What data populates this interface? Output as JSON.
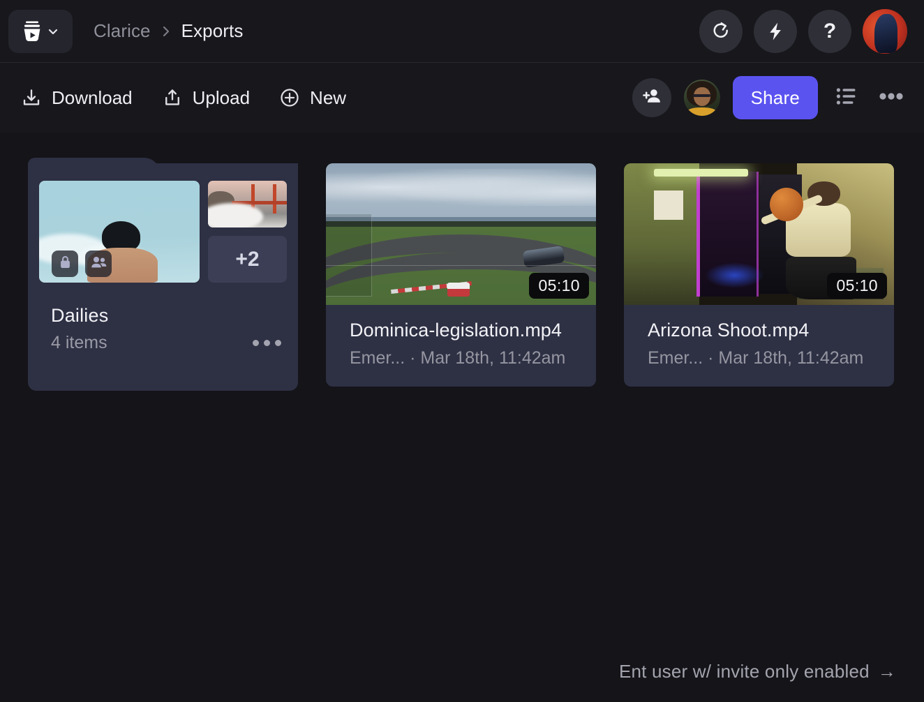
{
  "header": {
    "logo_icon": "frameio-bucket-logo",
    "logo_dropdown_icon": "chevron-down-icon",
    "breadcrumb": {
      "parent": "Clarice",
      "separator": "›",
      "current": "Exports"
    },
    "actions": [
      {
        "name": "refresh",
        "icon": "refresh-icon"
      },
      {
        "name": "lightning",
        "icon": "lightning-bolt-icon"
      },
      {
        "name": "help",
        "icon": "question-mark-icon",
        "glyph": "?"
      }
    ],
    "avatar": {
      "name": "user-avatar",
      "alt": "Account avatar"
    }
  },
  "toolbar": {
    "download_label": "Download",
    "download_icon": "download-icon",
    "upload_label": "Upload",
    "upload_icon": "upload-icon",
    "new_label": "New",
    "new_icon": "plus-circle-icon",
    "add_person_icon": "add-person-icon",
    "collaborator_avatar": "collaborator-avatar",
    "share_label": "Share",
    "share_color": "#5B53F0",
    "list_view_icon": "list-view-icon",
    "more_icon": "more-horizontal-icon"
  },
  "content": {
    "folder": {
      "title": "Dailies",
      "item_count": "4 items",
      "overflow_count": "+2",
      "badges": [
        {
          "name": "lock-badge",
          "icon": "lock-icon"
        },
        {
          "name": "people-badge",
          "icon": "people-icon"
        }
      ],
      "menu_icon": "more-horizontal-icon"
    },
    "assets": [
      {
        "title": "Dominica-legislation.mp4",
        "subtitle": "Emer... · Mar 18th, 11:42am",
        "duration": "05:10",
        "thumb": "racetrack-thumbnail"
      },
      {
        "title": "Arizona Shoot.mp4",
        "subtitle": "Emer... · Mar 18th, 11:42am",
        "duration": "05:10",
        "thumb": "neon-studio-thumbnail"
      }
    ]
  },
  "footer": {
    "note": "Ent user w/ invite only enabled",
    "arrow": "→"
  }
}
